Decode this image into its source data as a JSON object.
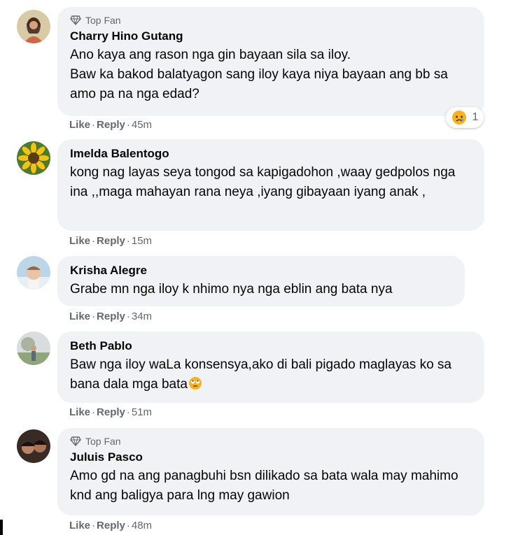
{
  "comments": [
    {
      "badge": "Top Fan",
      "name": "Charry Hino Gutang",
      "text": "Ano kaya ang rason nga gin bayaan sila sa iloy.\nBaw ka bakod balatyagon sang iloy kaya niya bayaan ang bb sa amo pa na nga edad?",
      "like": "Like",
      "reply": "Reply",
      "time": "45m",
      "reaction_count": "1",
      "reaction_icon": "sad-emoji-icon"
    },
    {
      "name": "Imelda Balentogo",
      "text": "kong nag layas seya tongod sa kapigadohon ,waay gedpolos nga ina ,,maga mahayan rana neya ,iyang gibayaan iyang anak ,",
      "like": "Like",
      "reply": "Reply",
      "time": "15m"
    },
    {
      "name": "Krisha Alegre",
      "text": "Grabe mn nga iloy k nhimo nya nga eblin ang bata nya",
      "like": "Like",
      "reply": "Reply",
      "time": "34m"
    },
    {
      "name": "Beth Pablo",
      "text": "Baw nga iloy waLa konsensya,ako di bali pigado maglayas ko sa bana dala mga bata",
      "like": "Like",
      "reply": "Reply",
      "time": "51m",
      "emoji": "rolling-eyes-emoji-icon"
    },
    {
      "badge": "Top Fan",
      "name": "Juluis Pasco",
      "text": "Amo gd na ang panagbuhi bsn dilikado sa bata wala may mahimo knd ang baligya para lng may gawion",
      "like": "Like",
      "reply": "Reply",
      "time": "48m"
    }
  ],
  "separator": "·",
  "colors": {
    "bubble": "#f0f2f5",
    "meta": "#65676b",
    "text": "#050505"
  }
}
